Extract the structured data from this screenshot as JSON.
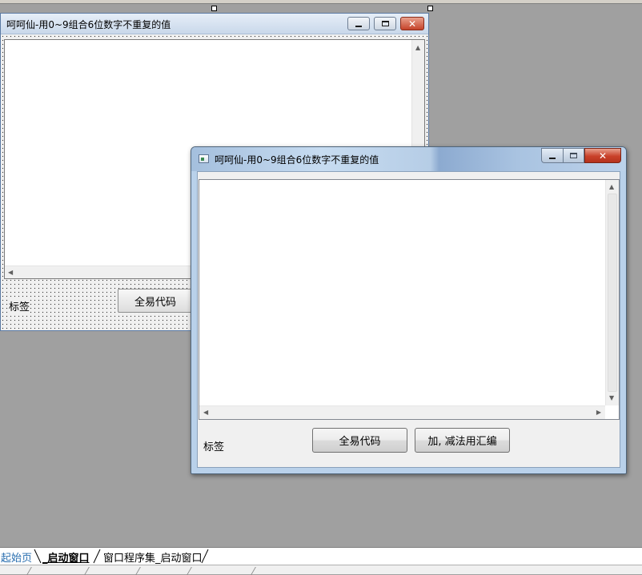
{
  "designer_window": {
    "title": "呵呵仙-用0~9组合6位数字不重复的值",
    "label_text": "标签",
    "button_label": "全易代码",
    "textbox_value": ""
  },
  "preview_window": {
    "title": "呵呵仙-用0~9组合6位数字不重复的值",
    "label_text": "标签",
    "button_1_label": "全易代码",
    "button_2_label": "加, 减法用汇编",
    "textbox_value": ""
  },
  "tabs": [
    {
      "label": "起始页"
    },
    {
      "label": "_启动窗口"
    },
    {
      "label": "窗口程序集_启动窗口"
    }
  ],
  "colors": {
    "workspace": "#a0a0a0",
    "start_tab": "#2a6fb0",
    "close_button": "#c9412a"
  }
}
